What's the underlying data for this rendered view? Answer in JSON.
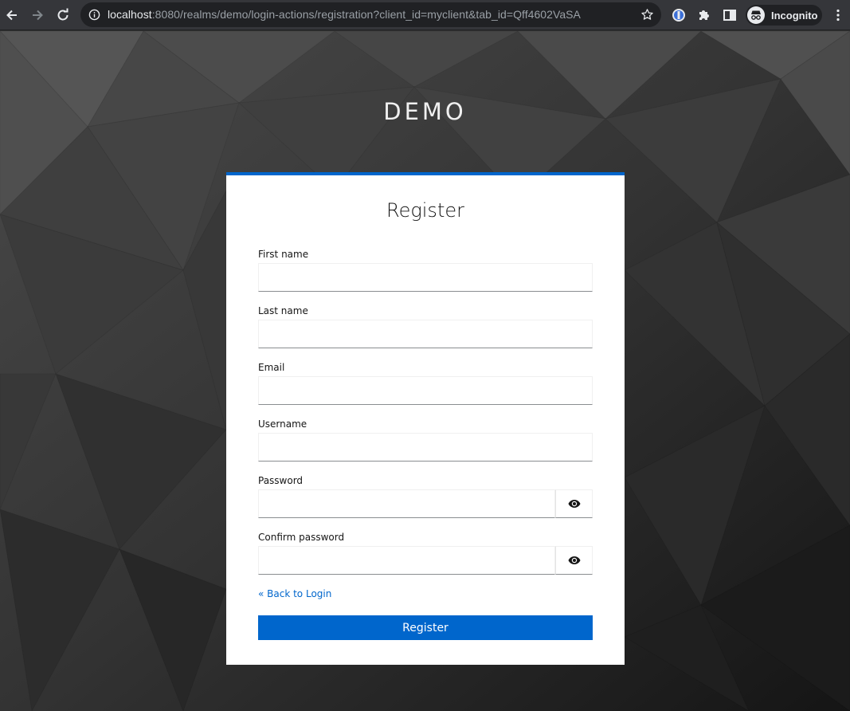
{
  "browser": {
    "url_host": "localhost",
    "url_rest": ":8080/realms/demo/login-actions/registration?client_id=myclient&tab_id=Qff4602VaSA",
    "profile_label": "Incognito"
  },
  "page": {
    "realm_title": "DEMO",
    "form_title": "Register",
    "fields": {
      "first_name": {
        "label": "First name",
        "value": ""
      },
      "last_name": {
        "label": "Last name",
        "value": ""
      },
      "email": {
        "label": "Email",
        "value": ""
      },
      "username": {
        "label": "Username",
        "value": ""
      },
      "password": {
        "label": "Password",
        "value": ""
      },
      "confirm_password": {
        "label": "Confirm password",
        "value": ""
      }
    },
    "back_link": "« Back to Login",
    "submit_label": "Register"
  },
  "colors": {
    "accent": "#0066cc",
    "background": "#2f2f2f",
    "card": "#ffffff"
  }
}
